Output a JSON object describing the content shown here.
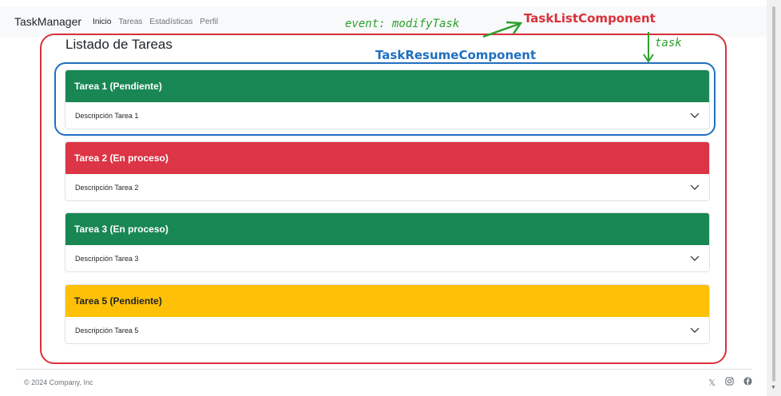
{
  "navbar": {
    "brand": "TaskManager",
    "links": [
      "Inicio",
      "Tareas",
      "Estadísticas",
      "Perfil"
    ]
  },
  "page": {
    "title": "Listado de Tareas"
  },
  "tasks": [
    {
      "title": "Tarea 1 (Pendiente)",
      "description": "Descripción Tarea 1",
      "color": "#198754"
    },
    {
      "title": "Tarea 2 (En proceso)",
      "description": "Descripción Tarea 2",
      "color": "#dc3545"
    },
    {
      "title": "Tarea 3 (En proceso)",
      "description": "Descripción Tarea 3",
      "color": "#198754"
    },
    {
      "title": "Tarea 5 (Pendiente)",
      "description": "Descripción Tarea 5",
      "color": "#ffc107"
    }
  ],
  "annotations": {
    "event": "event: modifyTask",
    "list_component": "TaskListComponent",
    "resume_component": "TaskResumeComponent",
    "task": "task",
    "colors": {
      "list": "#d9303a",
      "resume": "#1f6fbf",
      "event": "#2ca02c"
    }
  },
  "footer": {
    "copyright": "© 2024 Company, Inc",
    "icons": [
      "x-icon",
      "instagram-icon",
      "facebook-icon"
    ]
  }
}
